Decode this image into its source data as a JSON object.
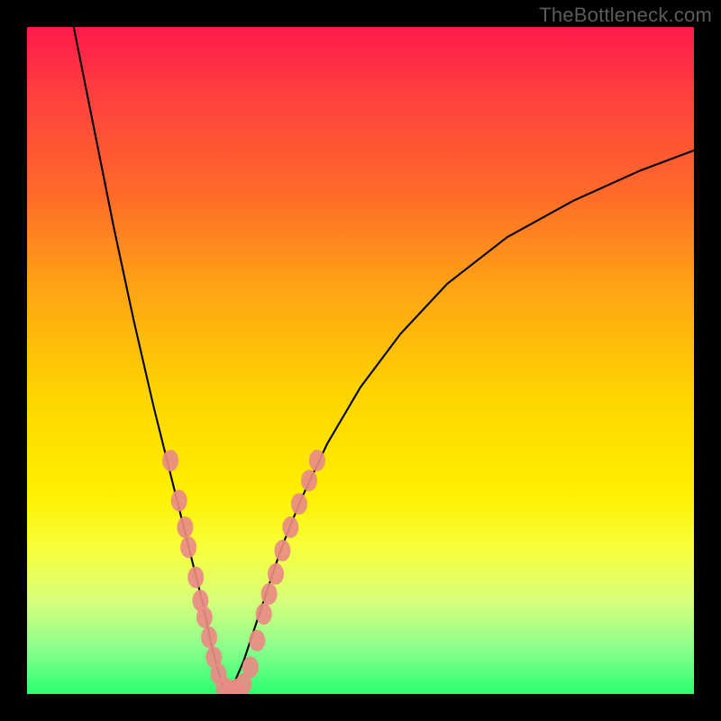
{
  "watermark": "TheBottleneck.com",
  "colors": {
    "background": "#000000",
    "gradient_top": "#ff1a4a",
    "gradient_bottom": "#2bff70",
    "curve": "#000000",
    "markers": "#e98b84"
  },
  "chart_data": {
    "type": "line",
    "title": "",
    "xlabel": "",
    "ylabel": "",
    "xlim": [
      0,
      100
    ],
    "ylim": [
      0,
      100
    ],
    "grid": false,
    "legend": false,
    "annotations": [
      "TheBottleneck.com"
    ],
    "series": [
      {
        "name": "left-curve",
        "x": [
          7,
          10,
          13,
          16,
          19,
          20.5,
          22,
          23.5,
          25,
          26.5,
          27.5,
          28.5,
          29.3,
          30
        ],
        "values": [
          100,
          85,
          70,
          56,
          43,
          37,
          31,
          25,
          19,
          13,
          8,
          4,
          1.5,
          0
        ]
      },
      {
        "name": "right-curve",
        "x": [
          30,
          31,
          32.5,
          34,
          36,
          38,
          41,
          45,
          50,
          56,
          63,
          72,
          82,
          92,
          100
        ],
        "values": [
          0,
          1.5,
          5,
          9.5,
          15.5,
          21.5,
          29,
          37.5,
          46,
          54,
          61.5,
          68.5,
          74,
          78.5,
          81.5
        ]
      }
    ],
    "markers": {
      "name": "highlighted-points",
      "points": [
        {
          "x": 21.5,
          "y": 35
        },
        {
          "x": 22.8,
          "y": 29
        },
        {
          "x": 23.7,
          "y": 25
        },
        {
          "x": 24.2,
          "y": 22
        },
        {
          "x": 25.3,
          "y": 17.5
        },
        {
          "x": 26.0,
          "y": 14
        },
        {
          "x": 26.6,
          "y": 11.5
        },
        {
          "x": 27.3,
          "y": 8.5
        },
        {
          "x": 28.0,
          "y": 5.5
        },
        {
          "x": 28.7,
          "y": 3
        },
        {
          "x": 29.5,
          "y": 1
        },
        {
          "x": 30.5,
          "y": 0.5
        },
        {
          "x": 31.5,
          "y": 0.7
        },
        {
          "x": 32.5,
          "y": 1.5
        },
        {
          "x": 33.5,
          "y": 4
        },
        {
          "x": 34.5,
          "y": 8
        },
        {
          "x": 35.5,
          "y": 12
        },
        {
          "x": 36.3,
          "y": 15
        },
        {
          "x": 37.3,
          "y": 18
        },
        {
          "x": 38.3,
          "y": 21.5
        },
        {
          "x": 39.5,
          "y": 25
        },
        {
          "x": 40.8,
          "y": 28.5
        },
        {
          "x": 42.3,
          "y": 32
        },
        {
          "x": 43.5,
          "y": 35
        }
      ]
    }
  }
}
